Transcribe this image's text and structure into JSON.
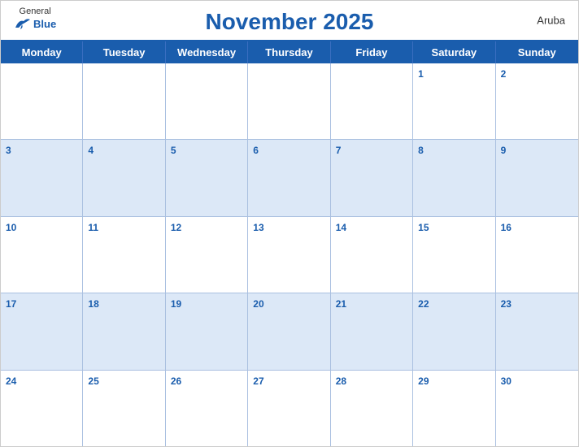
{
  "header": {
    "title": "November 2025",
    "country": "Aruba",
    "logo_general": "General",
    "logo_blue": "Blue"
  },
  "days_of_week": [
    "Monday",
    "Tuesday",
    "Wednesday",
    "Thursday",
    "Friday",
    "Saturday",
    "Sunday"
  ],
  "weeks": [
    [
      {
        "day": "",
        "empty": true
      },
      {
        "day": "",
        "empty": true
      },
      {
        "day": "",
        "empty": true
      },
      {
        "day": "",
        "empty": true
      },
      {
        "day": "",
        "empty": true
      },
      {
        "day": "1",
        "empty": false
      },
      {
        "day": "2",
        "empty": false
      }
    ],
    [
      {
        "day": "3",
        "empty": false
      },
      {
        "day": "4",
        "empty": false
      },
      {
        "day": "5",
        "empty": false
      },
      {
        "day": "6",
        "empty": false
      },
      {
        "day": "7",
        "empty": false
      },
      {
        "day": "8",
        "empty": false
      },
      {
        "day": "9",
        "empty": false
      }
    ],
    [
      {
        "day": "10",
        "empty": false
      },
      {
        "day": "11",
        "empty": false
      },
      {
        "day": "12",
        "empty": false
      },
      {
        "day": "13",
        "empty": false
      },
      {
        "day": "14",
        "empty": false
      },
      {
        "day": "15",
        "empty": false
      },
      {
        "day": "16",
        "empty": false
      }
    ],
    [
      {
        "day": "17",
        "empty": false
      },
      {
        "day": "18",
        "empty": false
      },
      {
        "day": "19",
        "empty": false
      },
      {
        "day": "20",
        "empty": false
      },
      {
        "day": "21",
        "empty": false
      },
      {
        "day": "22",
        "empty": false
      },
      {
        "day": "23",
        "empty": false
      }
    ],
    [
      {
        "day": "24",
        "empty": false
      },
      {
        "day": "25",
        "empty": false
      },
      {
        "day": "26",
        "empty": false
      },
      {
        "day": "27",
        "empty": false
      },
      {
        "day": "28",
        "empty": false
      },
      {
        "day": "29",
        "empty": false
      },
      {
        "day": "30",
        "empty": false
      }
    ]
  ],
  "colors": {
    "primary_blue": "#1a5dad",
    "light_blue_row": "#dce8f7",
    "white": "#ffffff"
  }
}
